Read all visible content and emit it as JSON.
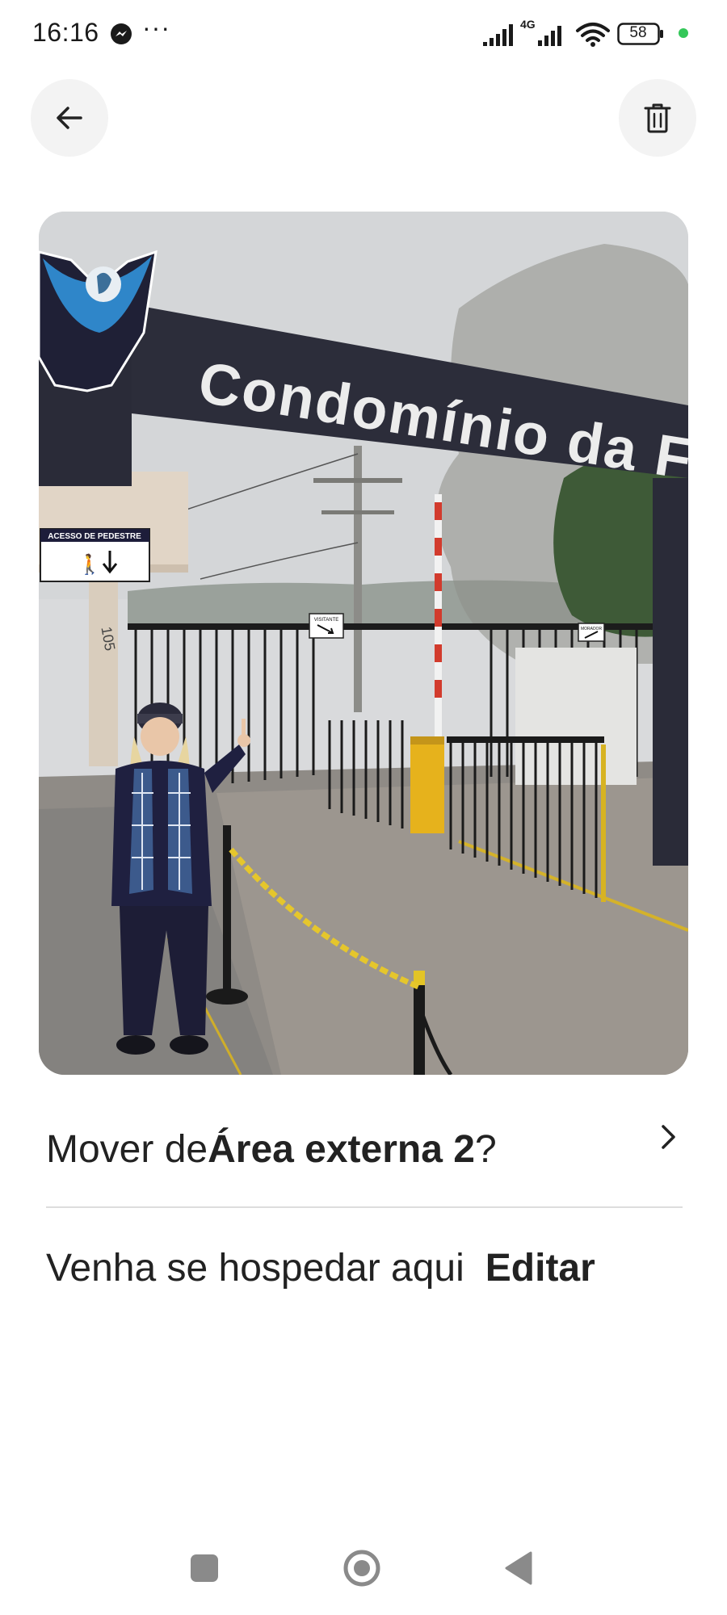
{
  "status_bar": {
    "time": "16:16",
    "more_indicator": "···",
    "network_type": "4G",
    "battery_level": "58",
    "icons": [
      "messenger-icon",
      "signal-icon",
      "wifi-icon",
      "battery-icon"
    ]
  },
  "header": {
    "back_icon": "arrow-left-icon",
    "delete_icon": "trash-icon"
  },
  "photo": {
    "sign_text": "Condomínio da Fé",
    "pedestrian_sign": "ACESSO DE PEDESTRE",
    "visitor_sign": "VISITANTE",
    "morador_sign": "MORADOR",
    "house_number": "105"
  },
  "move_row": {
    "prefix": "Mover de ",
    "area": "Área externa 2",
    "suffix": "?",
    "icon": "chevron-right-icon"
  },
  "caption_row": {
    "caption": "Venha se hospedar aqui",
    "edit_label": "Editar"
  },
  "nav_bar": {
    "recents_icon": "square-icon",
    "home_icon": "circle-icon",
    "back_icon": "triangle-back-icon"
  },
  "colors": {
    "text": "#222222",
    "divider": "#dddddd",
    "button_bg": "#f3f3f3",
    "status_green": "#34c759"
  }
}
